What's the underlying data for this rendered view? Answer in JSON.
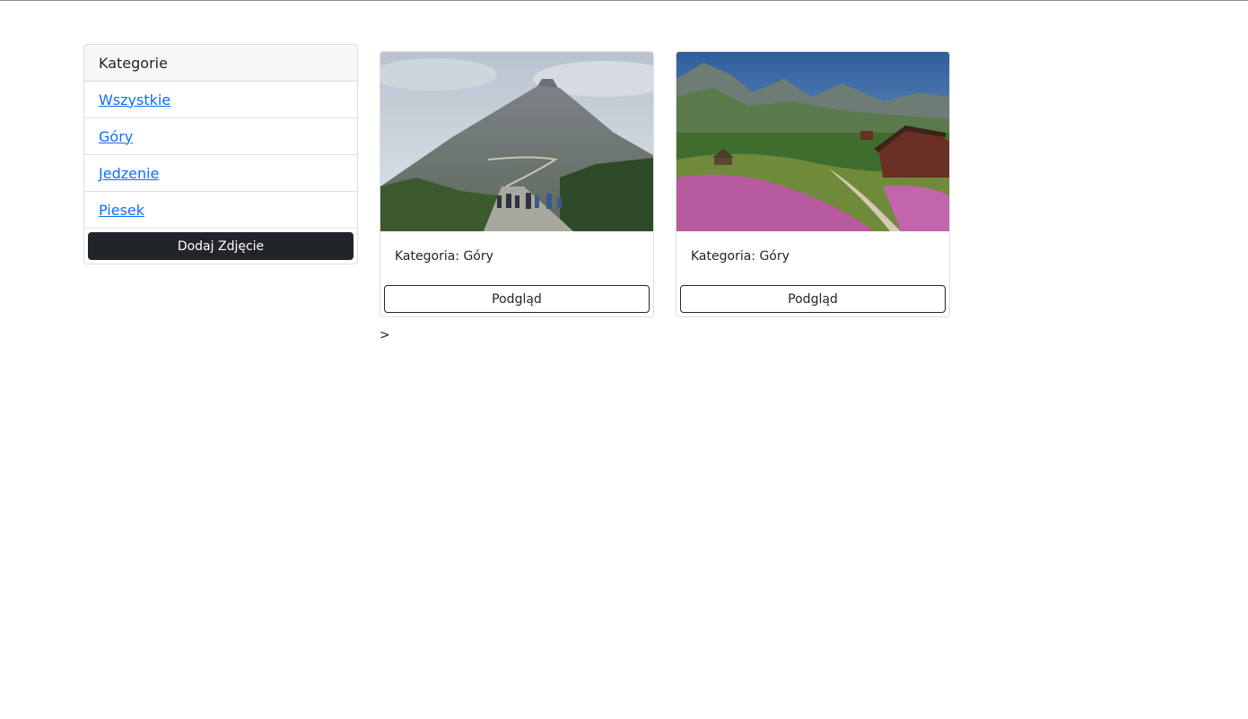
{
  "sidebar": {
    "header": "Kategorie",
    "items": [
      {
        "label": "Wszystkie"
      },
      {
        "label": "Góry"
      },
      {
        "label": "Jedzenie"
      },
      {
        "label": "Piesek"
      }
    ],
    "add_button_label": "Dodaj Zdjęcie"
  },
  "cards": [
    {
      "image_desc": "mountain-road-hikers-photo",
      "category_text": "Kategoria: Góry",
      "button_label": "Podgląd"
    },
    {
      "image_desc": "mountain-valley-flowers-cabins-photo",
      "category_text": "Kategoria: Góry",
      "button_label": "Podgląd"
    }
  ],
  "stray_text": ">",
  "colors": {
    "link": "#0d6efd",
    "dark_button": "#212529",
    "header_bg": "#f7f7f7"
  }
}
